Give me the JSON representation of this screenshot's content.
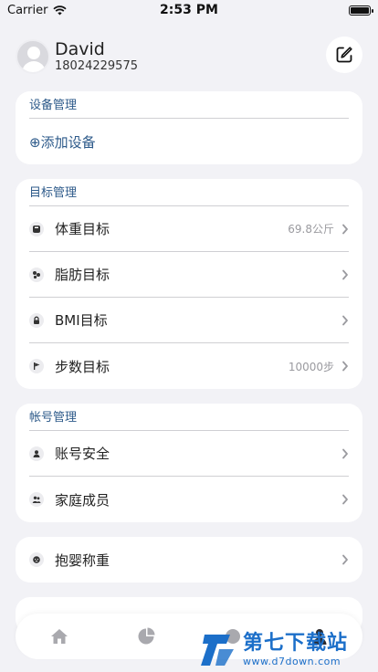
{
  "status_bar": {
    "carrier": "Carrier",
    "time": "2:53 PM",
    "battery_percent": 100
  },
  "profile": {
    "name": "David",
    "phone": "18024229575"
  },
  "device_section": {
    "title": "设备管理",
    "add_label": "⊕添加设备"
  },
  "goal_section": {
    "title": "目标管理",
    "items": [
      {
        "label": "体重目标",
        "value": "69.8公斤",
        "icon": "scale-icon"
      },
      {
        "label": "脂肪目标",
        "value": "",
        "icon": "fat-icon"
      },
      {
        "label": "BMI目标",
        "value": "",
        "icon": "lock-icon"
      },
      {
        "label": "步数目标",
        "value": "10000步",
        "icon": "flag-icon"
      }
    ]
  },
  "account_section": {
    "title": "帐号管理",
    "items": [
      {
        "label": "账号安全",
        "icon": "user-icon"
      },
      {
        "label": "家庭成员",
        "icon": "family-icon"
      }
    ]
  },
  "baby_section": {
    "label": "抱婴称重",
    "icon": "baby-icon"
  },
  "tab_bar": {
    "tabs": [
      "home-icon",
      "chart-icon",
      "discover-icon",
      "profile-icon"
    ]
  },
  "watermark": {
    "text": "第七下载站",
    "url": "www.d7down.com"
  },
  "colors": {
    "accent": "#2d5a8a",
    "background": "#f2f2f6",
    "watermark": "#1c6fc9"
  }
}
